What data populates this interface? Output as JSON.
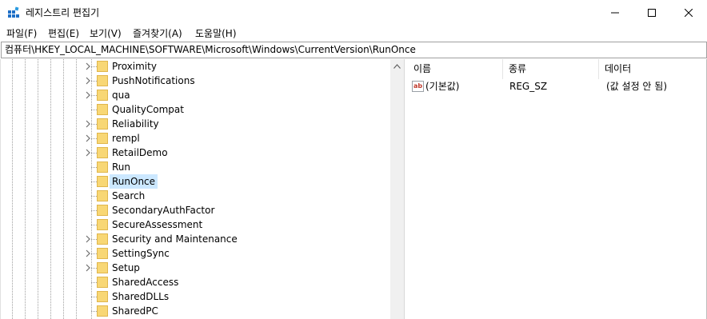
{
  "window": {
    "title": "레지스트리 편집기",
    "minimize_glyph": "—",
    "maximize_glyph": "☐",
    "close_glyph": "✕",
    "app_icon": "registry-editor-icon"
  },
  "menu": [
    {
      "label": "파일(F)"
    },
    {
      "label": "편집(E)"
    },
    {
      "label": "보기(V)"
    },
    {
      "label": "즐겨찾기(A)"
    },
    {
      "label": "도움말(H)"
    }
  ],
  "address": "컴퓨터\\HKEY_LOCAL_MACHINE\\SOFTWARE\\Microsoft\\Windows\\CurrentVersion\\RunOnce",
  "tree": {
    "items": [
      {
        "label": "Proximity",
        "expandable": true
      },
      {
        "label": "PushNotifications",
        "expandable": true
      },
      {
        "label": "qua",
        "expandable": true
      },
      {
        "label": "QualityCompat",
        "expandable": false
      },
      {
        "label": "Reliability",
        "expandable": true
      },
      {
        "label": "rempl",
        "expandable": true
      },
      {
        "label": "RetailDemo",
        "expandable": true
      },
      {
        "label": "Run",
        "expandable": false
      },
      {
        "label": "RunOnce",
        "expandable": false,
        "selected": true
      },
      {
        "label": "Search",
        "expandable": false
      },
      {
        "label": "SecondaryAuthFactor",
        "expandable": false
      },
      {
        "label": "SecureAssessment",
        "expandable": false
      },
      {
        "label": "Security and Maintenance",
        "expandable": true
      },
      {
        "label": "SettingSync",
        "expandable": true
      },
      {
        "label": "Setup",
        "expandable": true
      },
      {
        "label": "SharedAccess",
        "expandable": false
      },
      {
        "label": "SharedDLLs",
        "expandable": false
      },
      {
        "label": "SharedPC",
        "expandable": false
      }
    ]
  },
  "list": {
    "columns": [
      "이름",
      "종류",
      "데이터"
    ],
    "rows": [
      {
        "name": "(기본값)",
        "type": "REG_SZ",
        "data": "(값 설정 안 됨)",
        "icon": "string-value-icon"
      }
    ]
  },
  "colors": {
    "selection": "#cce8ff",
    "folder": "#f8d775"
  }
}
